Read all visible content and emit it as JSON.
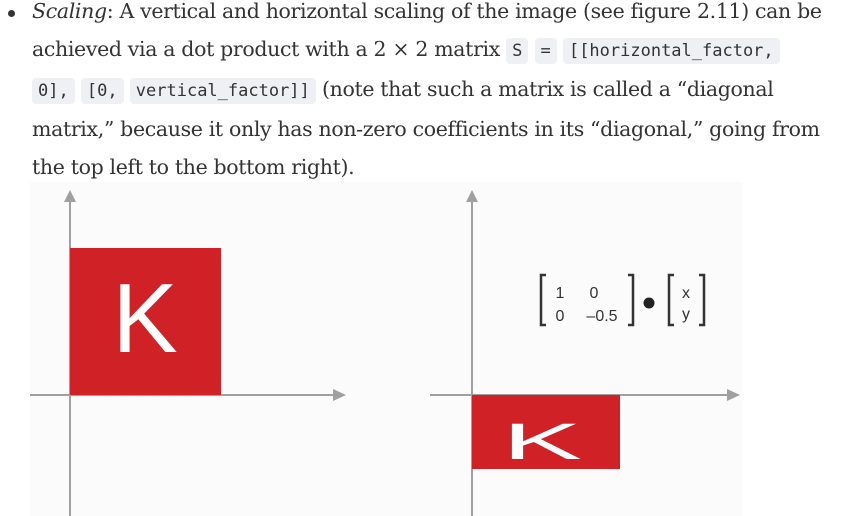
{
  "paragraph": {
    "term": "Scaling",
    "line1_rest": ": A vertical and horizontal scaling of the image (see figure 2.11) can be",
    "line2_text": "achieved via a dot product with a 2 × 2 matrix ",
    "code_s": "S",
    "code_eq": "=",
    "code_a": "[[horizontal_factor,",
    "code_b": "0],",
    "code_c": "[0,",
    "code_d": "vertical_factor]]",
    "line3_rest": " (note that such a matrix is called a “diagonal",
    "line4": "matrix,” because it only has non-zero coefficients in its “diagonal,” going from",
    "line5": "the top left to the bottom right)."
  },
  "figure": {
    "letter_left": "K",
    "letter_right": "K",
    "matrix": {
      "m11": "1",
      "m12": "0",
      "m21": "0",
      "m22": "–0.5"
    },
    "vector": {
      "v1": "x",
      "v2": "y"
    },
    "dot": "•",
    "colors": {
      "red": "#d02127",
      "axis": "#a0a0a0"
    }
  }
}
